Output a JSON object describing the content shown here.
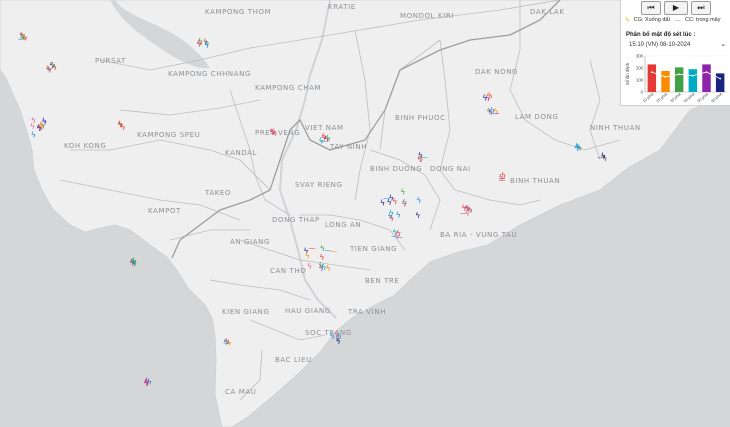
{
  "map": {
    "labels": [
      {
        "text": "KAMPONG THOM"
      },
      {
        "text": "KRATIE"
      },
      {
        "text": "MONDOL KIRI"
      },
      {
        "text": "DAK LAK"
      },
      {
        "text": "PURSAT"
      },
      {
        "text": "KAMPONG CHHNANG"
      },
      {
        "text": "KAMPONG CHAM"
      },
      {
        "text": "DAK NONG"
      },
      {
        "text": "KAMPONG SPEU"
      },
      {
        "text": "BINH PHUOC"
      },
      {
        "text": "LAM DONG"
      },
      {
        "text": "KOH KONG"
      },
      {
        "text": "KANDAL"
      },
      {
        "text": "TAY NINH"
      },
      {
        "text": "NINH THUAN"
      },
      {
        "text": "PREY VENG"
      },
      {
        "text": "SVAY RIENG"
      },
      {
        "text": "BINH DUONG"
      },
      {
        "text": "DONG NAI"
      },
      {
        "text": "TAKEO"
      },
      {
        "text": "BINH THUAN"
      },
      {
        "text": "KAMPOT"
      },
      {
        "text": "LONG AN"
      },
      {
        "text": "DONG THAP"
      },
      {
        "text": "BA RIA - VUNG TAU"
      },
      {
        "text": "AN GIANG"
      },
      {
        "text": "TIEN GIANG"
      },
      {
        "text": "CAN THO"
      },
      {
        "text": "BEN TRE"
      },
      {
        "text": "KIEN GIANG"
      },
      {
        "text": "HAU GIANG"
      },
      {
        "text": "TRA VINH"
      },
      {
        "text": "SOC TRANG"
      },
      {
        "text": "BAC LIEU"
      },
      {
        "text": "CA MAU"
      },
      {
        "text": "VIET NAM"
      }
    ],
    "strike_colors": [
      "#e53935",
      "#fb8c00",
      "#43a047",
      "#1e88e5",
      "#8e24aa",
      "#1a237e",
      "#00acc1",
      "#f06292"
    ]
  },
  "panel": {
    "controls": {
      "prev_icon": "⏮",
      "play_icon": "▶",
      "next_icon": "⏭"
    },
    "legend": {
      "cg_icon": "ϟ",
      "cg_label": "CG: Xuống đất",
      "cc_icon": "—",
      "cc_label": "CC: trong mây"
    },
    "title": "Phân bố mật độ sét lúc :",
    "time": "15:10 (VN) 08-10-2024",
    "chevron_icon": "⌄",
    "chart_data": {
      "type": "bar",
      "ylabel": "Số lần đánh",
      "yticks": [
        0,
        100,
        200,
        300
      ],
      "ylim": [
        0,
        300
      ],
      "categories": [
        "10 phút",
        "20 phút",
        "30 phút",
        "40 phút",
        "50 phút",
        "60 phút"
      ],
      "values": [
        230,
        175,
        205,
        190,
        230,
        155
      ],
      "colors": [
        "#e53935",
        "#fb8c00",
        "#43a047",
        "#00acc1",
        "#8e24aa",
        "#1a237e"
      ]
    }
  }
}
